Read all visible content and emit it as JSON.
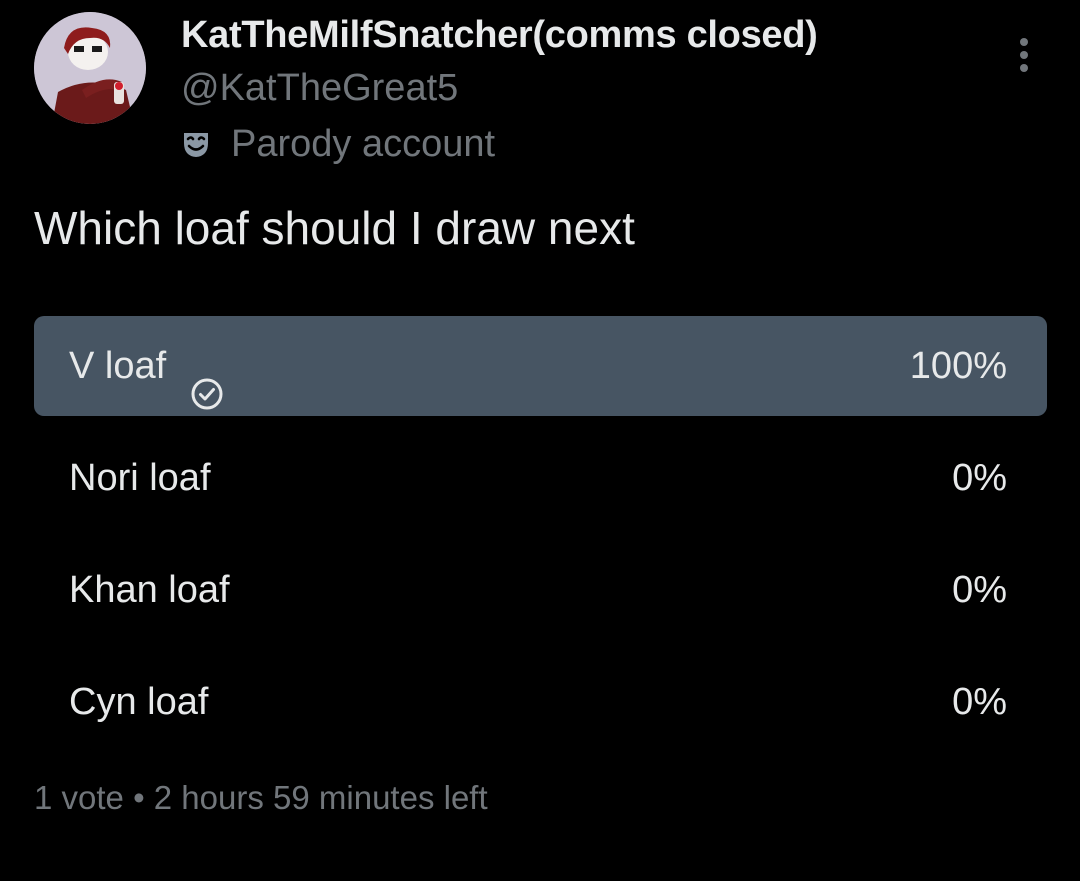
{
  "author": {
    "display_name": "KatTheMilfSnatcher(comms closed)",
    "handle": "@KatTheGreat5",
    "badge_icon": "theater-mask-icon",
    "badge_label": "Parody account",
    "avatar_icon": "user-avatar"
  },
  "menu": {
    "icon": "more-vertical-icon"
  },
  "tweet": {
    "text": "Which loaf should I draw next"
  },
  "poll": {
    "options": [
      {
        "label": "V loaf",
        "percent_label": "100%",
        "share": 1.0,
        "selected": true
      },
      {
        "label": "Nori loaf",
        "percent_label": "0%",
        "share": 0.0,
        "selected": false
      },
      {
        "label": "Khan loaf",
        "percent_label": "0%",
        "share": 0.0,
        "selected": false
      },
      {
        "label": "Cyn loaf",
        "percent_label": "0%",
        "share": 0.0,
        "selected": false
      }
    ],
    "footer": "1 vote • 2 hours 59 minutes left",
    "winner_bar_color": "#475563",
    "other_bar_color": "#333639",
    "selected_icon": "check-circle-icon"
  },
  "colors": {
    "background": "#000000",
    "primary_text": "#e7e9ea",
    "secondary_text": "#71767b"
  }
}
